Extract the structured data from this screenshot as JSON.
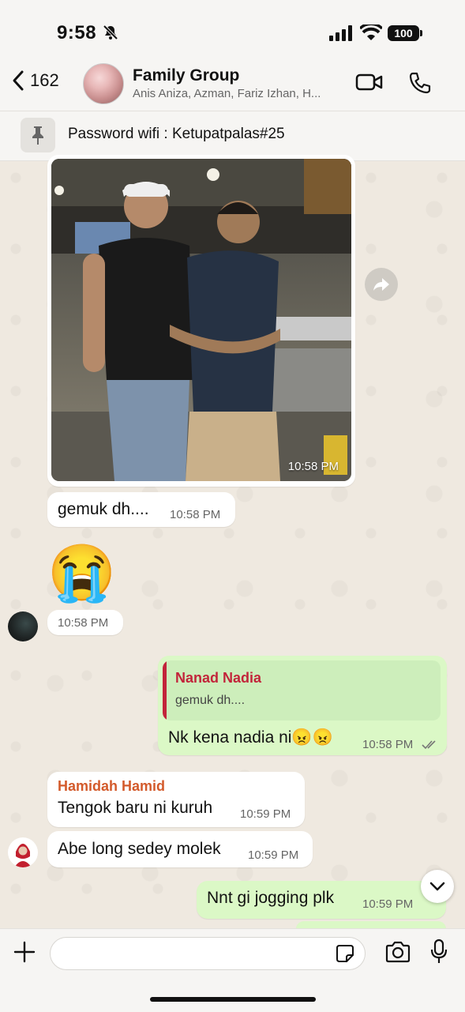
{
  "status_bar": {
    "time": "9:58",
    "battery": "100"
  },
  "header": {
    "back_count": "162",
    "title": "Family Group",
    "members": "Anis Aniza, Azman, Fariz Izhan, H..."
  },
  "pinned": {
    "text": "Password wifi : Ketupatpalas#25"
  },
  "messages": {
    "photo": {
      "time": "10:58 PM"
    },
    "m1": {
      "text": "gemuk dh....",
      "time": "10:58 PM"
    },
    "m2": {
      "emoji": "😭",
      "time": "10:58 PM"
    },
    "m3": {
      "quote_name": "Nanad Nadia",
      "quote_text": "gemuk dh....",
      "text": "Nk kena nadia ni😠😠",
      "time": "10:58 PM"
    },
    "m4": {
      "sender": "Hamidah Hamid",
      "text": "Tengok baru ni kuruh",
      "time": "10:59 PM"
    },
    "m5": {
      "text": "Abe long sedey molek",
      "time": "10:59 PM"
    },
    "m6": {
      "text": "Nnt gi jogging plk",
      "time": "10:59 PM"
    }
  },
  "input": {
    "placeholder": ""
  },
  "colors": {
    "outgoing_bubble": "#dbf8c6",
    "incoming_bubble": "#ffffff",
    "quote_accent": "#c2243a",
    "sender_name": "#d35a2b",
    "wallpaper": "#efe9e0"
  },
  "icons": [
    "bell-off-icon",
    "signal-icon",
    "wifi-icon",
    "battery-icon",
    "back-chevron-icon",
    "video-call-icon",
    "phone-icon",
    "pin-icon",
    "forward-icon",
    "double-tick-icon",
    "chevron-down-icon",
    "plus-icon",
    "sticker-icon",
    "camera-icon",
    "mic-icon"
  ]
}
